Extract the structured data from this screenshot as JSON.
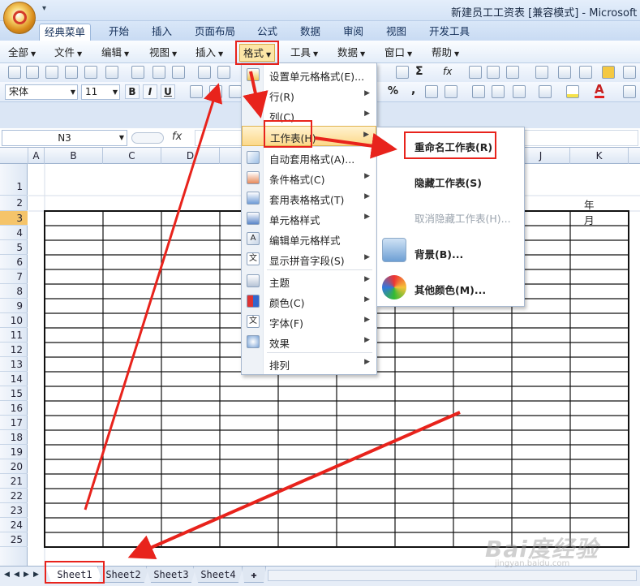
{
  "window": {
    "title": "新建员工工资表  [兼容模式] - Microsoft E"
  },
  "quick_access": "▾",
  "ribbon_tabs": [
    "经典菜单",
    "开始",
    "插入",
    "页面布局",
    "公式",
    "数据",
    "审阅",
    "视图",
    "开发工具"
  ],
  "menubar": [
    {
      "label": "全部"
    },
    {
      "label": "文件"
    },
    {
      "label": "编辑"
    },
    {
      "label": "视图"
    },
    {
      "label": "插入"
    },
    {
      "label": "格式"
    },
    {
      "label": "工具"
    },
    {
      "label": "数据"
    },
    {
      "label": "窗口"
    },
    {
      "label": "帮助"
    }
  ],
  "toolbar": {
    "font": "宋体",
    "size": "11",
    "bold": "B",
    "italic": "I",
    "underline": "U",
    "percent": "%",
    "comma": ",",
    "sigma": "Σ",
    "fx": "fx"
  },
  "formula_bar": {
    "name_box": "N3",
    "fx_label": "fx"
  },
  "columns": [
    "A",
    "B",
    "C",
    "D",
    "E",
    "F",
    "G",
    "H",
    "I",
    "J",
    "K"
  ],
  "rows": [
    "1",
    "2",
    "3",
    "4",
    "5",
    "6",
    "7",
    "8",
    "9",
    "10",
    "11",
    "12",
    "13",
    "14",
    "15",
    "16",
    "17",
    "18",
    "19",
    "20",
    "21",
    "22",
    "23",
    "24",
    "25"
  ],
  "active_row": "3",
  "sheet_cells": {
    "year_month": "年 月"
  },
  "format_menu": [
    {
      "label": "设置单元格格式(E)...",
      "icon": "format-cells-icon"
    },
    {
      "label": "行(R)",
      "submenu": true
    },
    {
      "label": "列(C)",
      "submenu": true
    },
    {
      "label": "工作表(H)",
      "submenu": true,
      "highlighted": true
    },
    {
      "label": "自动套用格式(A)...",
      "icon": "autoformat-icon"
    },
    {
      "label": "条件格式(C)",
      "icon": "conditional-format-icon",
      "submenu": true
    },
    {
      "label": "套用表格格式(T)",
      "icon": "table-style-icon",
      "submenu": true
    },
    {
      "label": "单元格样式",
      "icon": "cell-style-icon",
      "submenu": true
    },
    {
      "label": "编辑单元格样式",
      "icon": "edit-style-icon"
    },
    {
      "label": "显示拼音字段(S)",
      "icon": "pinyin-icon",
      "submenu": true
    },
    {
      "label": "主题",
      "icon": "theme-icon",
      "submenu": true
    },
    {
      "label": "颜色(C)",
      "icon": "color-icon",
      "submenu": true
    },
    {
      "label": "字体(F)",
      "icon": "font-icon",
      "submenu": true
    },
    {
      "label": "效果",
      "icon": "effects-icon",
      "submenu": true
    },
    {
      "label": "排列",
      "submenu": true
    }
  ],
  "sheet_submenu": [
    {
      "label": "重命名工作表(R)",
      "enabled": true
    },
    {
      "label": "隐藏工作表(S)",
      "enabled": true
    },
    {
      "label": "取消隐藏工作表(H)...",
      "enabled": false
    },
    {
      "label": "背景(B)...",
      "enabled": true,
      "icon": "background-icon"
    },
    {
      "label": "其他颜色(M)...",
      "enabled": true,
      "icon": "more-colors-icon"
    }
  ],
  "sheet_tabs": [
    "Sheet1",
    "Sheet2",
    "Sheet3",
    "Sheet4"
  ],
  "active_sheet": "Sheet1",
  "watermark": {
    "text": "Bai度经验",
    "sub": "jingyan.baidu.com"
  },
  "colors": {
    "annotation": "#e8231c",
    "menu_highlight": "#fcd889",
    "active_row": "#f5c46a"
  }
}
